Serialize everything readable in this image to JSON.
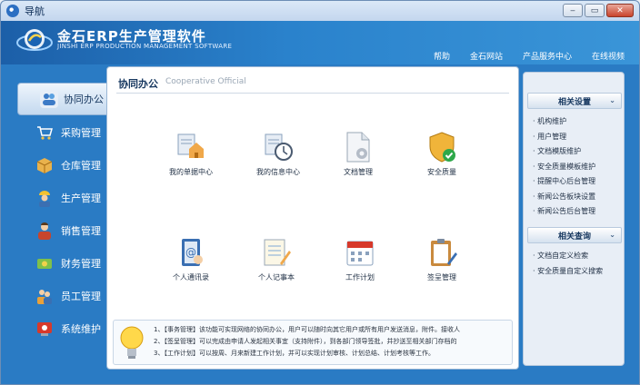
{
  "window": {
    "title": "导航",
    "min": "‒",
    "max": "▭",
    "close": "✕"
  },
  "brand": {
    "name_cn": "金石ERP生产管理软件",
    "name_en": "JINSHI ERP PRODUCTION MANAGEMENT SOFTWARE"
  },
  "topnav": [
    "帮助",
    "金石网站",
    "产品服务中心",
    "在线视频"
  ],
  "sidebar": [
    {
      "label": "协同办公",
      "icon": "people-icon",
      "active": true
    },
    {
      "label": "采购管理",
      "icon": "cart-icon"
    },
    {
      "label": "仓库管理",
      "icon": "box-icon"
    },
    {
      "label": "生产管理",
      "icon": "worker-icon"
    },
    {
      "label": "销售管理",
      "icon": "salesperson-icon"
    },
    {
      "label": "财务管理",
      "icon": "money-icon"
    },
    {
      "label": "员工管理",
      "icon": "staff-icon"
    },
    {
      "label": "系统维护",
      "icon": "tools-icon"
    }
  ],
  "main": {
    "title": "协同办公",
    "subtitle": "Cooperative Official",
    "apps": [
      {
        "label": "我的单据中心",
        "icon": "document-house-icon"
      },
      {
        "label": "我的信息中心",
        "icon": "clock-document-icon"
      },
      {
        "label": "文档管理",
        "icon": "gear-document-icon"
      },
      {
        "label": "安全质量",
        "icon": "shield-check-icon"
      },
      {
        "label": "个人通讯录",
        "icon": "address-book-icon"
      },
      {
        "label": "个人记事本",
        "icon": "notepad-icon"
      },
      {
        "label": "工作计划",
        "icon": "calendar-icon"
      },
      {
        "label": "签呈管理",
        "icon": "clipboard-icon"
      }
    ],
    "info": [
      "1、【事务管理】该功能可实现网络的协同办公，用户可以随时向其它用户或所有用户发送消息，附件。接收人",
      "2、【签呈管理】可以完成由申请人发起相关事宜（支持附件），到各部门领导签批，并抄送至相关部门存档的",
      "3、【工作计划】可以按周、月来新建工作计划，并可以实现计划审核、计划总结、计划考核等工作。"
    ]
  },
  "right_panel": {
    "sections": [
      {
        "title": "相关设置",
        "items": [
          "机构维护",
          "用户管理",
          "文档模版维护",
          "安全质量模板维护",
          "提醒中心后台管理",
          "新闻公告板块设置",
          "新闻公告后台管理"
        ]
      },
      {
        "title": "相关查询",
        "items": [
          "文档自定义检索",
          "安全质量自定义搜索"
        ]
      }
    ],
    "chevron": "⌄"
  }
}
